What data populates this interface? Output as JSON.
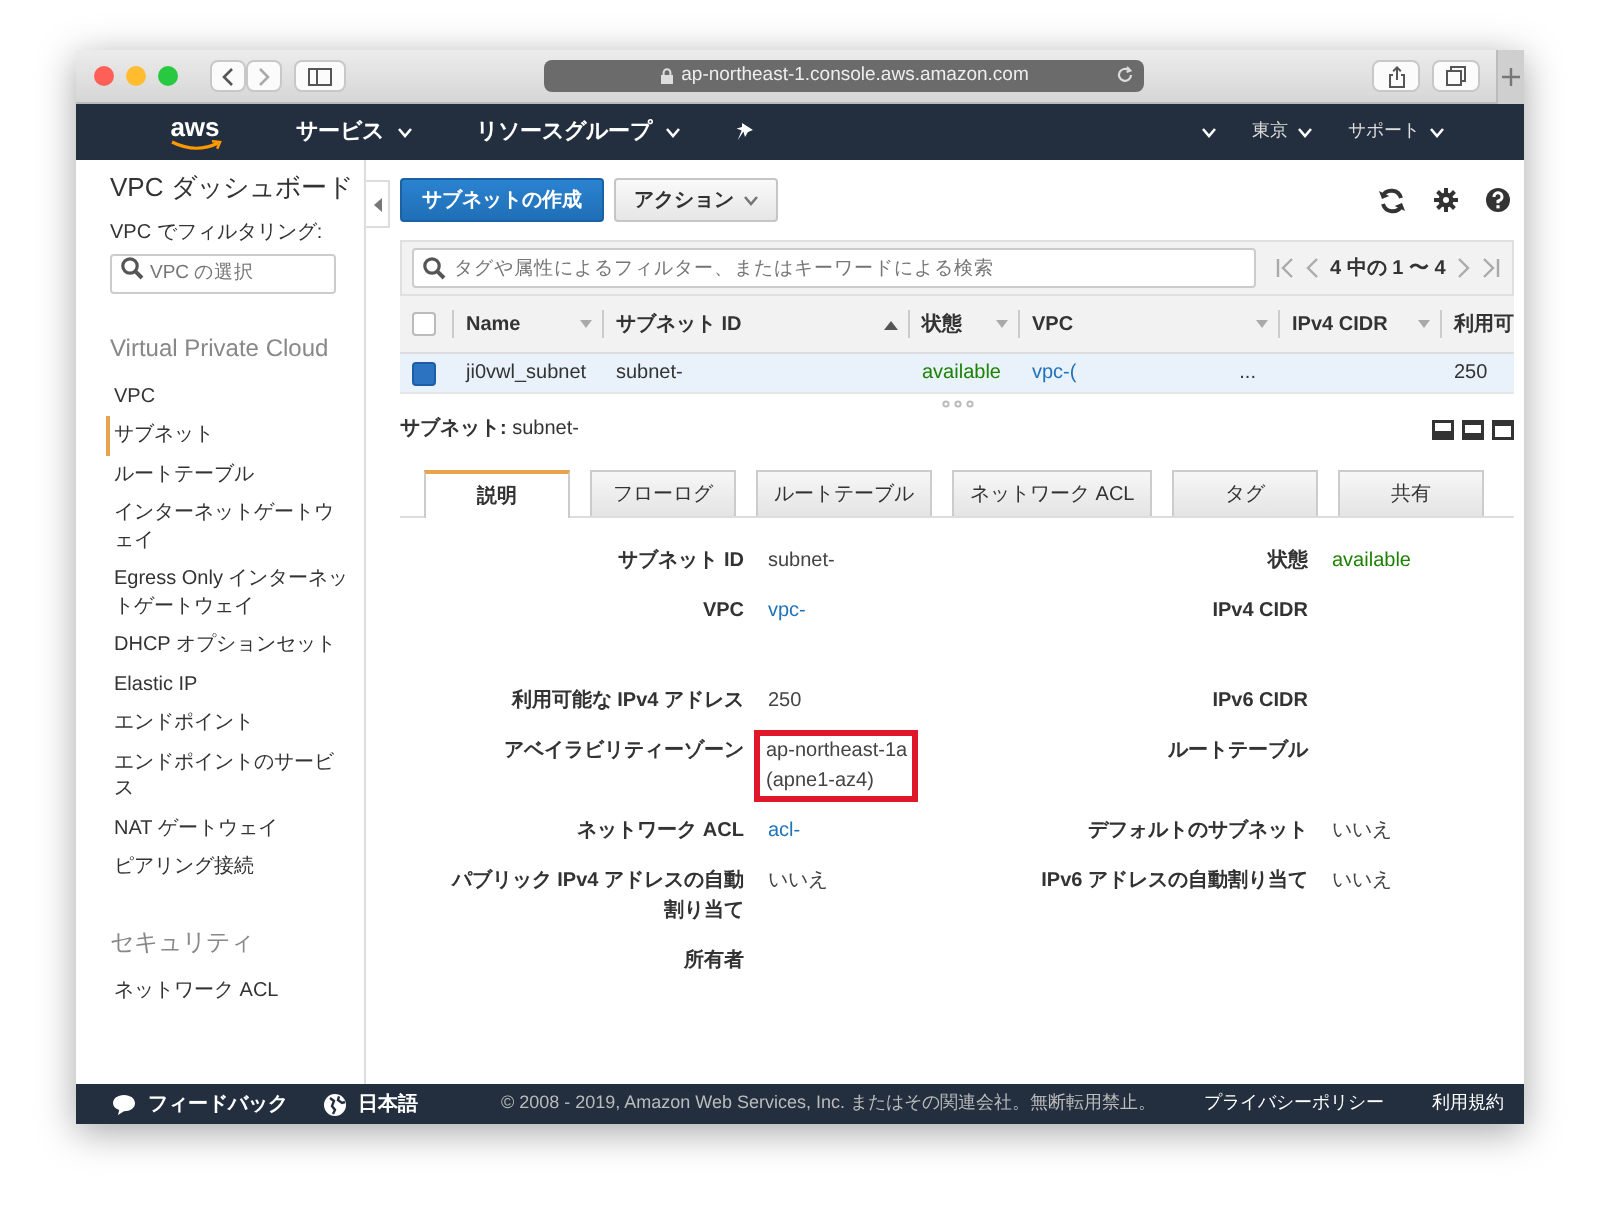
{
  "browser": {
    "url": "ap-northeast-1.console.aws.amazon.com"
  },
  "navbar": {
    "logo": "aws",
    "menus": [
      "サービス",
      "リソースグループ"
    ],
    "right_menus": [
      "東京",
      "サポート"
    ]
  },
  "sidebar": {
    "title": "VPC ダッシュボード",
    "filter_label": "VPC でフィルタリング:",
    "filter_placeholder": "VPC の選択",
    "groups": [
      {
        "heading": "Virtual Private Cloud",
        "items": [
          {
            "label": "VPC",
            "selected": false
          },
          {
            "label": "サブネット",
            "selected": true
          },
          {
            "label": "ルートテーブル",
            "selected": false
          },
          {
            "label": "インターネットゲートウェイ",
            "selected": false
          },
          {
            "label": "Egress Only インターネットゲートウェイ",
            "selected": false
          },
          {
            "label": "DHCP オプションセット",
            "selected": false
          },
          {
            "label": "Elastic IP",
            "selected": false
          },
          {
            "label": "エンドポイント",
            "selected": false
          },
          {
            "label": "エンドポイントのサービス",
            "selected": false
          },
          {
            "label": "NAT ゲートウェイ",
            "selected": false
          },
          {
            "label": "ピアリング接続",
            "selected": false
          }
        ]
      },
      {
        "heading": "セキュリティ",
        "items": [
          {
            "label": "ネットワーク ACL",
            "selected": false
          }
        ]
      }
    ]
  },
  "toolbar": {
    "create_button": "サブネットの作成",
    "actions_button": "アクション"
  },
  "filter": {
    "placeholder": "タグや属性によるフィルター、またはキーワードによる検索",
    "pagination": "4 中の 1 〜 4"
  },
  "table": {
    "all_checked": false,
    "columns": [
      {
        "label": "Name",
        "sorted": false
      },
      {
        "label": "サブネット ID",
        "sorted": true
      },
      {
        "label": "状態",
        "sorted": false
      },
      {
        "label": "VPC",
        "sorted": false
      },
      {
        "label": "IPv4 CIDR",
        "sorted": false
      },
      {
        "label": "利用可"
      }
    ],
    "rows": [
      {
        "selected": true,
        "checked": true,
        "cells": [
          {
            "kind": "text",
            "text": "ji0vwl_subnet"
          },
          {
            "kind": "text",
            "text": "subnet-"
          },
          {
            "kind": "status",
            "text": "available"
          },
          {
            "kind": "link",
            "text": "vpc-(",
            "extra": "..."
          },
          {
            "kind": "blank"
          },
          {
            "kind": "text",
            "text": "250"
          }
        ]
      }
    ]
  },
  "detail": {
    "title": "**サブネット:** subnet-",
    "tabs": [
      {
        "label": "説明",
        "selected": true
      },
      {
        "label": "フローログ",
        "selected": false
      },
      {
        "label": "ルートテーブル",
        "selected": false
      },
      {
        "label": "ネットワーク ACL",
        "selected": false
      },
      {
        "label": "タグ",
        "selected": false
      },
      {
        "label": "共有",
        "selected": false
      }
    ],
    "rows": [
      {
        "left": {
          "label": "サブネット ID",
          "kind": "text",
          "value": [
            "subnet-"
          ]
        },
        "right": {
          "label": "状態",
          "kind": "status",
          "value": [
            "available"
          ]
        }
      },
      {
        "left": {
          "label": "VPC",
          "kind": "link",
          "value": [
            "vpc-"
          ]
        },
        "right": {
          "label": "IPv4 CIDR"
        }
      },
      {
        "left": {
          "label": "利用可能な IPv4 アドレス",
          "kind": "text",
          "value": [
            "250"
          ]
        },
        "right": {
          "label": "IPv6 CIDR"
        }
      },
      {
        "left": {
          "label": "アベイラビリティーゾーン",
          "kind": "text",
          "value": [
            "ap-northeast-1a",
            "(apne1-az4)"
          ],
          "highlighted": true
        },
        "right": {
          "label": "ルートテーブル"
        }
      },
      {
        "left": {
          "label": "ネットワーク ACL",
          "kind": "link",
          "value": [
            "acl-"
          ]
        },
        "right": {
          "label": "デフォルトのサブネット",
          "kind": "text",
          "value": [
            "いいえ"
          ]
        }
      },
      {
        "left": {
          "label": "パブリック IPv4 アドレスの自動割り当て",
          "kind": "text",
          "value": [
            "いいえ"
          ]
        },
        "right": {
          "label": "IPv6 アドレスの自動割り当て",
          "kind": "text",
          "value": [
            "いいえ"
          ]
        }
      },
      {
        "left": {
          "label": "所有者"
        }
      }
    ]
  },
  "footer": {
    "feedback": "フィードバック",
    "language": "日本語",
    "copyright": "© 2008 - 2019, Amazon Web Services, Inc. またはその関連会社。無断転用禁止。",
    "links": [
      "プライバシーポリシー",
      "利用規約"
    ]
  }
}
